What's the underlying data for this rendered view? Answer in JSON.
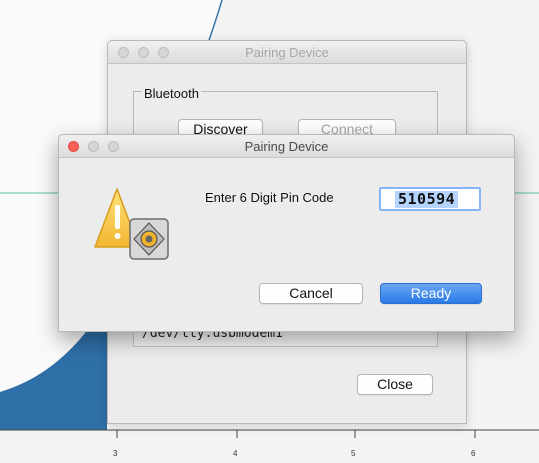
{
  "background": {
    "x_ticks": [
      "3",
      "4",
      "5",
      "6"
    ],
    "colors": {
      "curve": "#2f6fa8",
      "baseline": "#5ec0a8"
    }
  },
  "back_window": {
    "title": "Pairing Device",
    "group_title": "Bluetooth",
    "discover_label": "Discover",
    "connect_label": "Connect",
    "port_value": "/dev/tty.usbmodem1",
    "close_label": "Close"
  },
  "dialog": {
    "title": "Pairing Device",
    "prompt": "Enter 6 Digit Pin Code",
    "pin_value": "510594",
    "cancel_label": "Cancel",
    "ready_label": "Ready",
    "icon": "caution-icon",
    "colors": {
      "accent": "#2a79e6",
      "close": "#fc5f57"
    }
  }
}
